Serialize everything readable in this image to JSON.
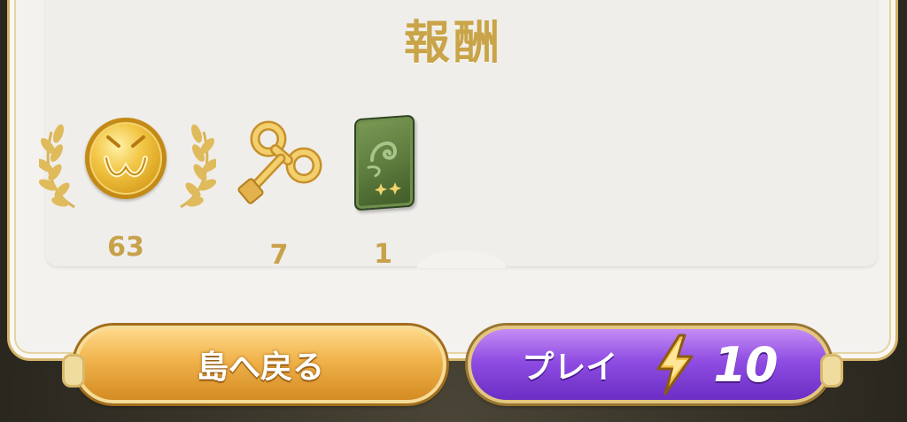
{
  "panel": {
    "title": "報酬"
  },
  "rewards": [
    {
      "item": "coin",
      "icon": "gold-coin-icon",
      "count": "63",
      "decoration": "laurel"
    },
    {
      "item": "wind-up-key",
      "icon": "wind-up-key-icon",
      "count": "7"
    },
    {
      "item": "green-card-pack",
      "icon": "green-card-pack-icon",
      "count": "1"
    }
  ],
  "buttons": {
    "back_label": "島へ戻る",
    "play_label": "プレイ",
    "play_cost": "10",
    "play_cost_icon": "lightning-bolt-icon"
  },
  "colors": {
    "title_gold": "#c9a448",
    "back_button": "#f0b24a",
    "play_button": "#8f4de2",
    "panel_bg": "#f4f2ef"
  }
}
